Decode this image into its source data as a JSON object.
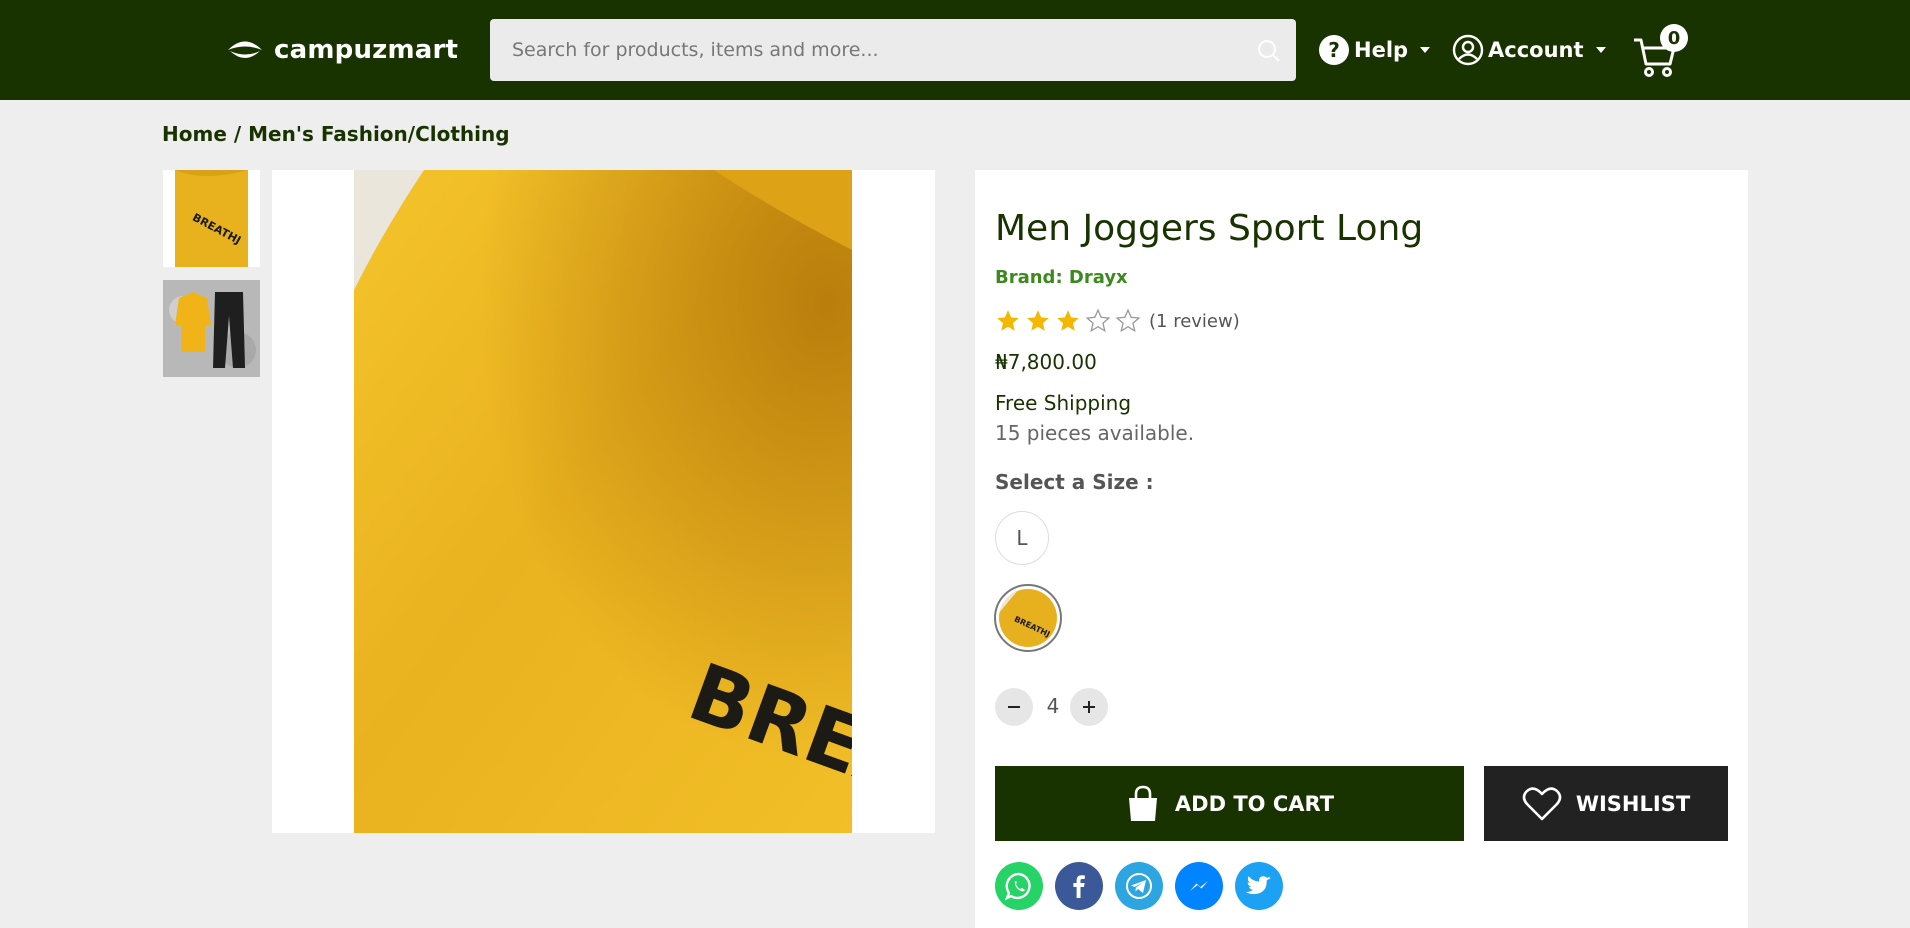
{
  "header": {
    "logo_text": "campuzmart",
    "search_placeholder": "Search for products, items and more...",
    "help_label": "Help",
    "account_label": "Account",
    "cart_count": "0",
    "bg_color": "#193300"
  },
  "breadcrumb": {
    "home": "Home",
    "separator": " / ",
    "category": "Men's Fashion/Clothing"
  },
  "gallery": {
    "photo_text": "BREATHJ"
  },
  "product": {
    "title": "Men Joggers Sport Long",
    "brand": "Brand: Drayx",
    "rating": 3,
    "rating_max": 5,
    "review_count": "(1 review)",
    "price": "₦7,800.00",
    "shipping": "Free Shipping",
    "availability": "15 pieces available.",
    "size_label": "Select a Size :",
    "sizes": [
      "L"
    ],
    "quantity": "4",
    "add_to_cart_label": "ADD TO CART",
    "wishlist_label": "WISHLIST"
  },
  "share": [
    "whatsapp-icon",
    "facebook-icon",
    "telegram-icon",
    "messenger-icon",
    "twitter-icon"
  ],
  "colors": {
    "accent_green": "#193300",
    "brand_green": "#3c8a1e",
    "star_gold": "#f5b800",
    "whatsapp": "#25d366",
    "facebook": "#3b5998",
    "telegram": "#2ca5e0",
    "messenger": "#0084ff",
    "twitter": "#1da1f2"
  }
}
